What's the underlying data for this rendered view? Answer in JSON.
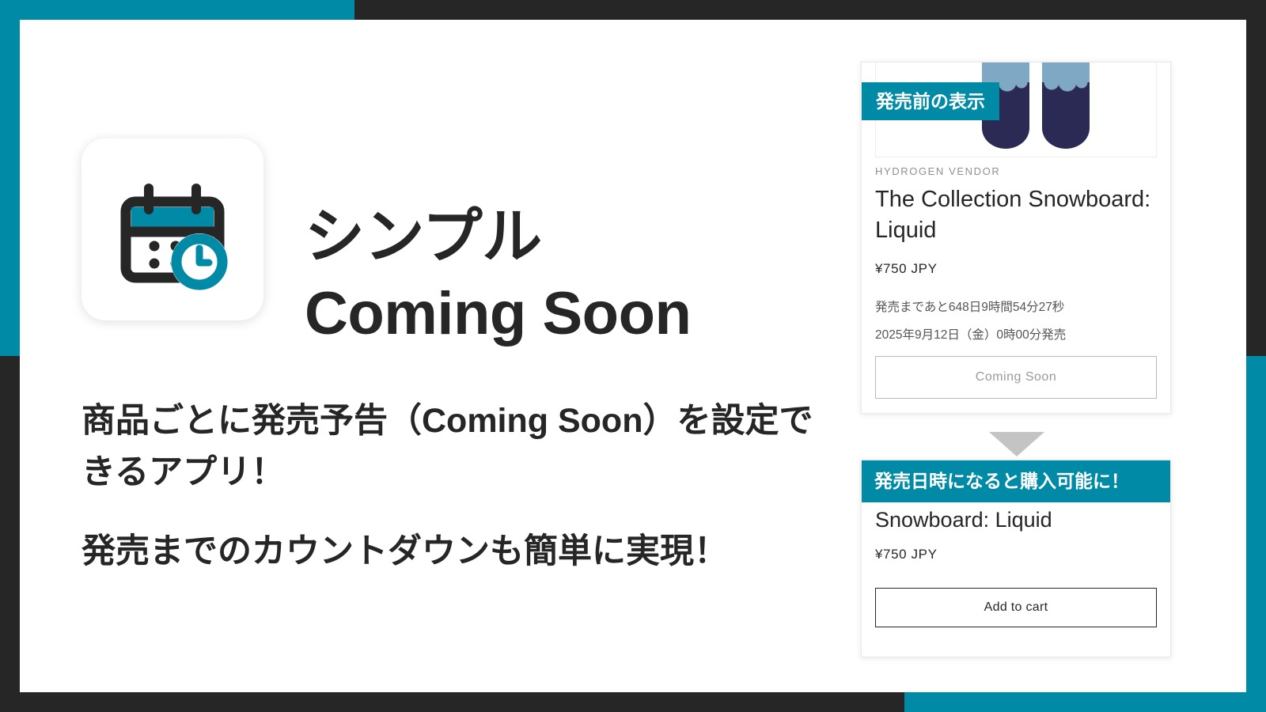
{
  "frame": {
    "accent_teal": "#018aa6",
    "dark": "#262626"
  },
  "app_icon": {
    "name": "calendar-clock-icon",
    "calendar_color": "#262626",
    "clock_color": "#018aa6"
  },
  "headline": {
    "line1": "シンプル",
    "line2": "Coming Soon"
  },
  "body": {
    "paragraph1": "商品ごとに発売予告（Coming Soon）を設定できるアプリ！",
    "paragraph2": "発売までのカウントダウンも簡単に実現！"
  },
  "cards": {
    "before": {
      "badge": "発売前の表示",
      "vendor": "HYDROGEN VENDOR",
      "title": "The Collection Snowboard: Liquid",
      "price": "¥750 JPY",
      "countdown": "発売まであと648日9時間54分27秒",
      "release_date": "2025年9月12日（金）0時00分発売",
      "button": "Coming Soon"
    },
    "after": {
      "badge": "発売日時になると購入可能に！",
      "title": "Snowboard: Liquid",
      "price": "¥750 JPY",
      "button": "Add to cart"
    }
  }
}
